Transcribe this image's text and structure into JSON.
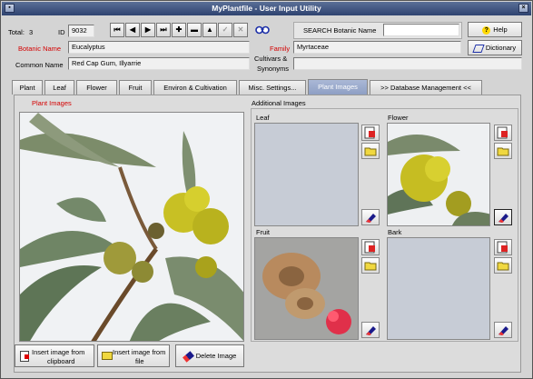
{
  "window": {
    "title": "MyPlantfile - User Input Utility"
  },
  "record": {
    "total_label": "Total:",
    "total_value": "3",
    "id_label": "ID",
    "id_value": "9032"
  },
  "nav": [
    "first-icon",
    "prev-icon",
    "next-icon",
    "last-icon",
    "add-icon",
    "remove-icon",
    "up-icon",
    "confirm-icon",
    "cancel-icon"
  ],
  "search": {
    "label": "SEARCH Botanic Name",
    "value": ""
  },
  "buttons": {
    "help": "Help",
    "dictionary": "Dictionary"
  },
  "fields": {
    "botanic_label": "Botanic Name",
    "botanic_value": "Eucalyptus",
    "common_label": "Common Name",
    "common_value": "Red Cap Gum, Illyarrie",
    "family_label": "Family",
    "family_value": "Myrtaceae",
    "cultivars_label_1": "Cultivars &",
    "cultivars_label_2": "Synonyms",
    "cultivars_value": ""
  },
  "tabs": [
    "Plant",
    "Leaf",
    "Flower",
    "Fruit",
    "Environ & Cultivation",
    "Misc. Settings...",
    "Plant Images",
    ">> Database  Management <<"
  ],
  "active_tab": "Plant Images",
  "images": {
    "main_title": "Plant Images",
    "additional_title": "Additional Images",
    "leaf": "Leaf",
    "flower": "Flower",
    "fruit": "Fruit",
    "bark": "Bark",
    "insert_clip_1": "Insert image from",
    "insert_clip_2": "clipboard",
    "insert_file_1": "Insert image from",
    "insert_file_2": "file",
    "delete": "Delete Image"
  },
  "colors": {
    "title_bar": "#3d5282",
    "active_tab": "#9aa9cc",
    "required_label": "#d40000"
  }
}
